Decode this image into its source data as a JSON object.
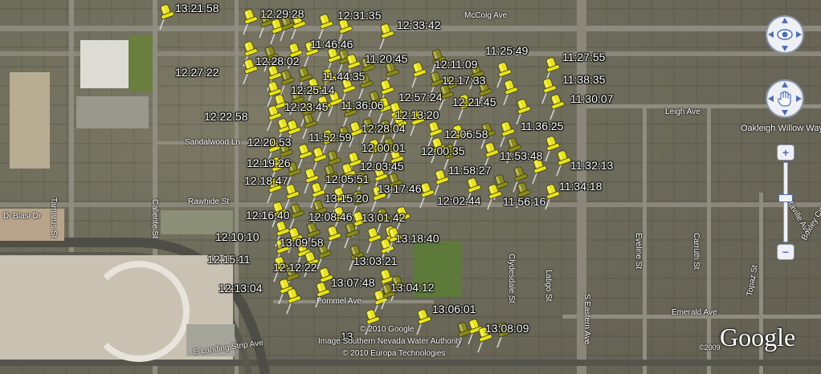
{
  "streets": [
    {
      "name": "McCoig Ave"
    },
    {
      "name": "Leigh Ave"
    },
    {
      "name": "Oakleigh Willow Way"
    },
    {
      "name": "Sandalwood Ln"
    },
    {
      "name": "Rawhide St"
    },
    {
      "name": "Di Blasi Dr"
    },
    {
      "name": "Tamarus St"
    },
    {
      "name": "Caliente St"
    },
    {
      "name": "Clydesdale St"
    },
    {
      "name": "Latigo St"
    },
    {
      "name": "S Eastern Ave"
    },
    {
      "name": "Eveline St"
    },
    {
      "name": "Carruth St"
    },
    {
      "name": "Emerald Ave"
    },
    {
      "name": "Pommel Ave"
    },
    {
      "name": "E Landing Strip Ave"
    },
    {
      "name": "Raville Ave"
    },
    {
      "name": "Boxley Cir"
    },
    {
      "name": "Topaz St"
    }
  ],
  "timestamps": [
    {
      "label": "13:21:58"
    },
    {
      "label": "12:29:28"
    },
    {
      "label": "12:31:35"
    },
    {
      "label": "12:33:42"
    },
    {
      "label": "11:46:46"
    },
    {
      "label": "11:25:49"
    },
    {
      "label": "11:27:55"
    },
    {
      "label": "12:28:02"
    },
    {
      "label": "11:20:45"
    },
    {
      "label": "12:11:09"
    },
    {
      "label": "12:27:22"
    },
    {
      "label": "11:44:35"
    },
    {
      "label": "12:17:33"
    },
    {
      "label": "11:38:35"
    },
    {
      "label": "12:25:14"
    },
    {
      "label": "12:57:24"
    },
    {
      "label": "11:30:07"
    },
    {
      "label": "12:23:45"
    },
    {
      "label": "11:36:06"
    },
    {
      "label": "12:21:45"
    },
    {
      "label": "12:22:58"
    },
    {
      "label": "12:13:20"
    },
    {
      "label": "11:36:25"
    },
    {
      "label": "12:28:04"
    },
    {
      "label": "12:06:58"
    },
    {
      "label": "12:20:53"
    },
    {
      "label": "11:52:59"
    },
    {
      "label": "12:00:01"
    },
    {
      "label": "12:00:35"
    },
    {
      "label": "11:53:48"
    },
    {
      "label": "12:19:26"
    },
    {
      "label": "12:03:45"
    },
    {
      "label": "11:58:27"
    },
    {
      "label": "11:32:13"
    },
    {
      "label": "12:18:47"
    },
    {
      "label": "12:05:51"
    },
    {
      "label": "13:17:46"
    },
    {
      "label": "11:34:18"
    },
    {
      "label": "13:15:20"
    },
    {
      "label": "12:02:44"
    },
    {
      "label": "11:56:16"
    },
    {
      "label": "12:16:40"
    },
    {
      "label": "12:08:46"
    },
    {
      "label": "13:01:42"
    },
    {
      "label": "12:10:10"
    },
    {
      "label": "13:18:40"
    },
    {
      "label": "13:09:58"
    },
    {
      "label": "12:15:11"
    },
    {
      "label": "13:03:21"
    },
    {
      "label": "12:12:22"
    },
    {
      "label": "12:13:04"
    },
    {
      "label": "13:07:48"
    },
    {
      "label": "13:04:12"
    },
    {
      "label": "13:06:01"
    },
    {
      "label": "13:08:09"
    },
    {
      "label": "13"
    }
  ],
  "credits": {
    "line1": "© 2010 Google",
    "line2": "Image Southern Nevada Water Authority",
    "line3": "© 2010 Europa Technologies",
    "year": "©2009",
    "logo": "Google"
  },
  "controls": {
    "look_icon": "eye-icon",
    "move_icon": "hand-icon",
    "zoom_in": "+",
    "zoom_out": "−"
  },
  "colors": {
    "pin_yellow": "#e8e21a",
    "pin_olive": "#8a8a1e",
    "road": "#9a968a"
  }
}
